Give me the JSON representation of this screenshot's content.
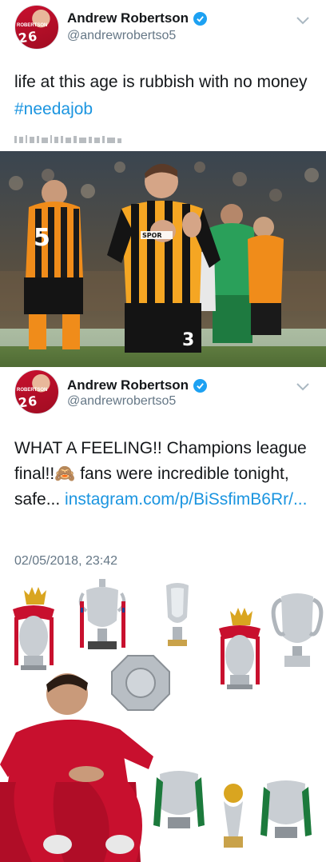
{
  "tweet1": {
    "display_name": "Andrew Robertson",
    "handle": "@andrewrobertso5",
    "text_before": "life at this age is rubbish with no money ",
    "hashtag": "#needajob",
    "avatar_text": "26",
    "avatar_small": "ROBERTSON"
  },
  "photo1": {
    "player_number": "3",
    "bg_player_number": "5",
    "sponsor": "SPOR"
  },
  "tweet2": {
    "display_name": "Andrew Robertson",
    "handle": "@andrewrobertso5",
    "text_before": "WHAT A FEELING!! Champions league final!!",
    "emoji": "🙈",
    "text_after": " fans were incredible tonight, safe... ",
    "link": "instagram.com/p/BiSsfimB6Rr/...",
    "timestamp": "02/05/2018, 23:42",
    "avatar_text": "26",
    "avatar_small": "ROBERTSON"
  },
  "photo2": {
    "caption": "",
    "colors": {
      "red": "#c8102e",
      "silver": "#c9ced3",
      "gold": "#d9a520",
      "green": "#1c7a3c"
    }
  },
  "colors": {
    "link": "#1b95e0",
    "verified": "#1da1f2",
    "muted": "#657786",
    "hull_orange": "#f5a623"
  }
}
